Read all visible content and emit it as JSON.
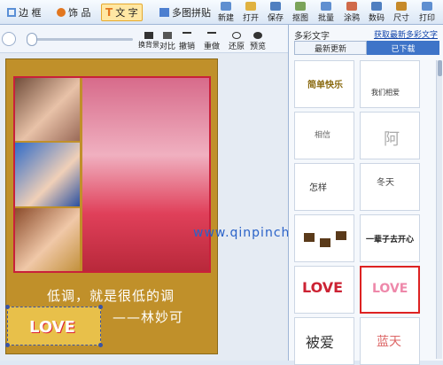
{
  "topbar": {
    "tabs": [
      {
        "label": "边 框",
        "icon": "frame-icon",
        "color": "#5a8fd6"
      },
      {
        "label": "饰 品",
        "icon": "ornament-icon",
        "color": "#e2761f"
      },
      {
        "label": "文 字",
        "icon": "text-icon",
        "color": "#e2761f",
        "active": true
      },
      {
        "label": "多图拼贴",
        "icon": "collage-icon",
        "color": "#4d7fd0"
      }
    ],
    "tools": [
      {
        "label": "新建",
        "icon": "new-icon",
        "color": "#5f8fd0"
      },
      {
        "label": "打开",
        "icon": "open-icon",
        "color": "#e0b240"
      },
      {
        "label": "保存",
        "icon": "save-icon",
        "color": "#4f7fc0"
      },
      {
        "label": "抠图",
        "icon": "cutout-icon",
        "color": "#7aa35a"
      },
      {
        "label": "批量",
        "icon": "batch-icon",
        "color": "#5f8fd0"
      },
      {
        "label": "涂鸦",
        "icon": "doodle-icon",
        "color": "#d06a4a"
      },
      {
        "label": "数码",
        "icon": "digital-icon",
        "color": "#4f7fc0"
      },
      {
        "label": "尺寸",
        "icon": "size-icon",
        "color": "#c68a2a"
      },
      {
        "label": "打印",
        "icon": "print-icon",
        "color": "#5f8fd0"
      }
    ]
  },
  "subbar": {
    "buttons": [
      {
        "label": "换背景",
        "icon": "background-icon"
      },
      {
        "label": "对比",
        "icon": "compare-icon"
      },
      {
        "label": "撤销",
        "icon": "undo-icon"
      },
      {
        "label": "重做",
        "icon": "redo-icon"
      },
      {
        "label": "还原",
        "icon": "restore-icon"
      },
      {
        "label": "预览",
        "icon": "preview-icon"
      }
    ]
  },
  "canvas": {
    "caption_line1": "低调，就是很低的调",
    "caption_line2": "——林妙可",
    "sticker_text": "LOVE",
    "watermark": "www.qinpinchang.com"
  },
  "right_panel": {
    "title": "多彩文字",
    "link": "获取最新多彩文字",
    "tabs": [
      {
        "label": "最新更新",
        "active": false
      },
      {
        "label": "已下载",
        "active": true
      }
    ],
    "thumbnails": [
      {
        "text": "简单快乐",
        "color": "#8a6a10"
      },
      {
        "text": "我们相爱",
        "color": "#333"
      },
      {
        "text": "相信",
        "color": "#666"
      },
      {
        "text": "阿",
        "color": "#999"
      },
      {
        "text": "怎样",
        "color": "#333"
      },
      {
        "text": "冬天",
        "color": "#444"
      },
      {
        "text": "",
        "color": "#5a3a1a"
      },
      {
        "text": "一辈子去开心",
        "color": "#222"
      },
      {
        "text": "LOVE",
        "color": "#c23"
      },
      {
        "text": "LOVE",
        "color": "#e8a"
      },
      {
        "text": "被爱",
        "color": "#333"
      },
      {
        "text": "蓝天",
        "color": "#d66"
      }
    ]
  }
}
